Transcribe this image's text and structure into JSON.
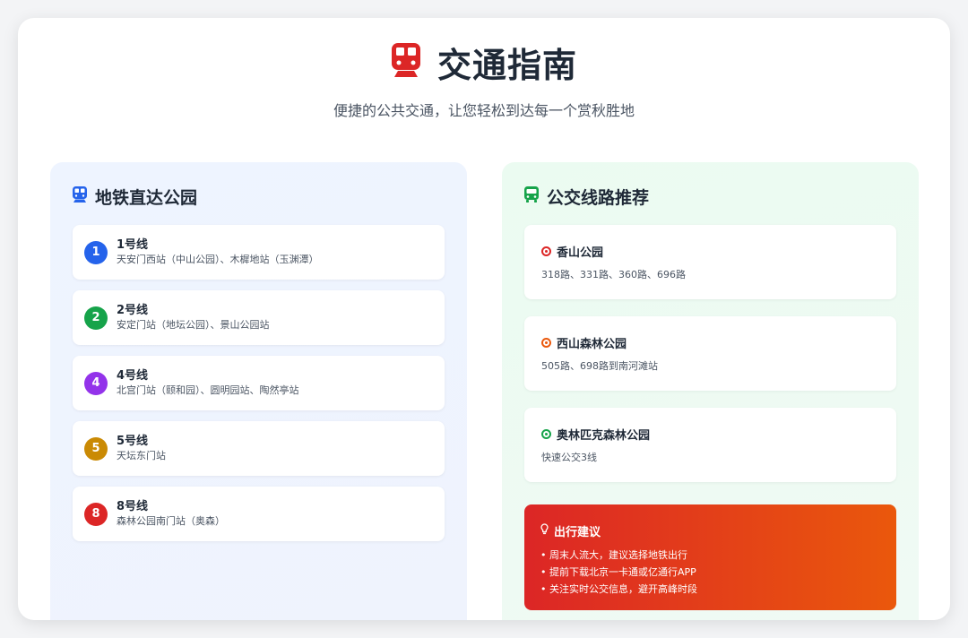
{
  "header": {
    "title": "交通指南",
    "subtitle": "便捷的公共交通，让您轻松到达每一个赏秋胜地",
    "icon": "train-icon",
    "icon_color": "#dc2626"
  },
  "subway": {
    "title": "地铁直达公园",
    "icon": "subway-icon",
    "icon_color": "#2563eb",
    "lines": [
      {
        "badge": "1",
        "name": "1号线",
        "stations": "天安门西站（中山公园）、木樨地站（玉渊潭）",
        "color": "#2563eb"
      },
      {
        "badge": "2",
        "name": "2号线",
        "stations": "安定门站（地坛公园）、景山公园站",
        "color": "#16a34a"
      },
      {
        "badge": "4",
        "name": "4号线",
        "stations": "北宫门站（颐和园）、圆明园站、陶然亭站",
        "color": "#9333ea"
      },
      {
        "badge": "5",
        "name": "5号线",
        "stations": "天坛东门站",
        "color": "#ca8a04"
      },
      {
        "badge": "8",
        "name": "8号线",
        "stations": "森林公园南门站（奥森）",
        "color": "#dc2626"
      }
    ]
  },
  "bus": {
    "title": "公交线路推荐",
    "icon": "bus-icon",
    "icon_color": "#16a34a",
    "routes": [
      {
        "name": "香山公园",
        "routes": "318路、331路、360路、696路",
        "color": "#dc2626"
      },
      {
        "name": "西山森林公园",
        "routes": "505路、698路到南河滩站",
        "color": "#ea580c"
      },
      {
        "name": "奥林匹克森林公园",
        "routes": "快速公交3线",
        "color": "#16a34a"
      }
    ]
  },
  "tips": {
    "title": "出行建议",
    "icon": "lightbulb-icon",
    "items": [
      "周末人流大，建议选择地铁出行",
      "提前下载北京一卡通或亿通行APP",
      "关注实时公交信息，避开高峰时段"
    ]
  }
}
